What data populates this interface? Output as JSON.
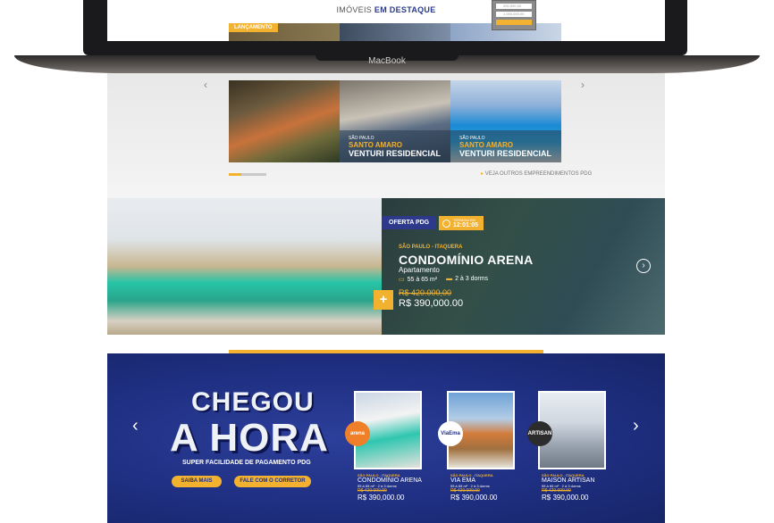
{
  "laptop": {
    "brand_label": "MacBook",
    "screen_heading_prefix": "IMÓVEIS",
    "screen_heading_bold": "EM DESTAQUE",
    "launch_badge": "LANÇAMENTO",
    "price_filter": [
      "200.000,00",
      "1.000.000,00"
    ]
  },
  "top_section": {
    "cards": [
      {
        "city": "",
        "hood": "",
        "name": ""
      },
      {
        "city": "SÃO PAULO",
        "hood": "SANTO AMARO",
        "name": "VENTURI RESIDENCIAL"
      },
      {
        "city": "SÃO PAULO",
        "hood": "SANTO AMARO",
        "name": "VENTURI RESIDENCIAL"
      }
    ],
    "see_more": "VEJA OUTROS EMPREENDIMENTOS PDG"
  },
  "offer": {
    "tag": "OFERTA PDG",
    "timer_label": "TERMINA EM",
    "timer_value": "12:01:05",
    "city": "SÃO PAULO - ITAQUERA",
    "title": "CONDOMÍNIO ARENA",
    "type": "Apartamento",
    "area": "55 à 65 m²",
    "rooms": "2 à 3 dorms",
    "plus": "+",
    "old_price": "R$ 420.000,00",
    "new_price": "R$ 390,000.00",
    "next": "›"
  },
  "promo": {
    "headline_1": "CHEGOU",
    "headline_2": "A HORA",
    "subtitle": "SUPER FACILIDADE DE PAGAMENTO PDG",
    "btn_more": "SAIBA MAIS",
    "btn_broker": "FALE COM O CORRETOR",
    "prev": "‹",
    "next": "›",
    "cards": [
      {
        "logo": "arena",
        "city": "SÃO PAULO - ITAQUERA",
        "name": "CONDOMÍNIO ARENA",
        "specs": "55 à 65 m²  ·  2 à 3 dorms",
        "old": "R$ 420.000,00",
        "price": "R$ 390,000.00"
      },
      {
        "logo": "ViaEma",
        "city": "SÃO PAULO - ITAQUERA",
        "name": "VIA EMA",
        "specs": "55 à 65 m²  ·  2 à 3 dorms",
        "old": "R$ 420.000,00",
        "price": "R$ 390,000.00"
      },
      {
        "logo": "ARTISAN",
        "city": "SÃO PAULO - ITAQUERA",
        "name": "MAISON ARTISAN",
        "specs": "55 à 65 m²  ·  2 à 3 dorms",
        "old": "R$ 420.000,00",
        "price": "R$ 390,000.00"
      }
    ]
  },
  "colors": {
    "accent": "#f2b12f",
    "brand_blue": "#1f2f82"
  }
}
